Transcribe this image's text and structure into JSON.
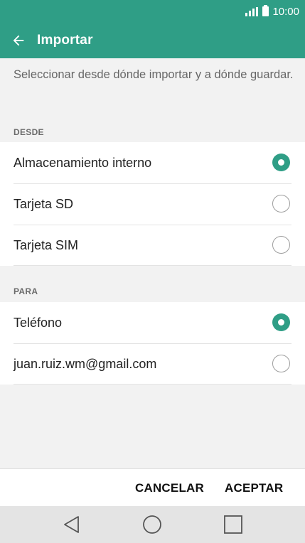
{
  "status_bar": {
    "time": "10:00",
    "icons": [
      "signal-icon",
      "battery-icon"
    ]
  },
  "app_bar": {
    "title": "Importar",
    "back_icon": "arrow-left-icon"
  },
  "description": "Seleccionar desde dónde importar y a dónde guardar.",
  "sections": [
    {
      "header": "DESDE",
      "options": [
        {
          "label": "Almacenamiento interno",
          "selected": true
        },
        {
          "label": "Tarjeta SD",
          "selected": false
        },
        {
          "label": "Tarjeta SIM",
          "selected": false
        }
      ]
    },
    {
      "header": "PARA",
      "options": [
        {
          "label": "Teléfono",
          "selected": true
        },
        {
          "label": "juan.ruiz.wm@gmail.com",
          "selected": false
        }
      ]
    }
  ],
  "actions": {
    "cancel": "CANCELAR",
    "accept": "ACEPTAR"
  },
  "nav_bar": {
    "icons": [
      "back-triangle-icon",
      "home-circle-icon",
      "recents-square-icon"
    ]
  },
  "colors": {
    "accent": "#2f9e86",
    "background": "#f2f2f2"
  }
}
